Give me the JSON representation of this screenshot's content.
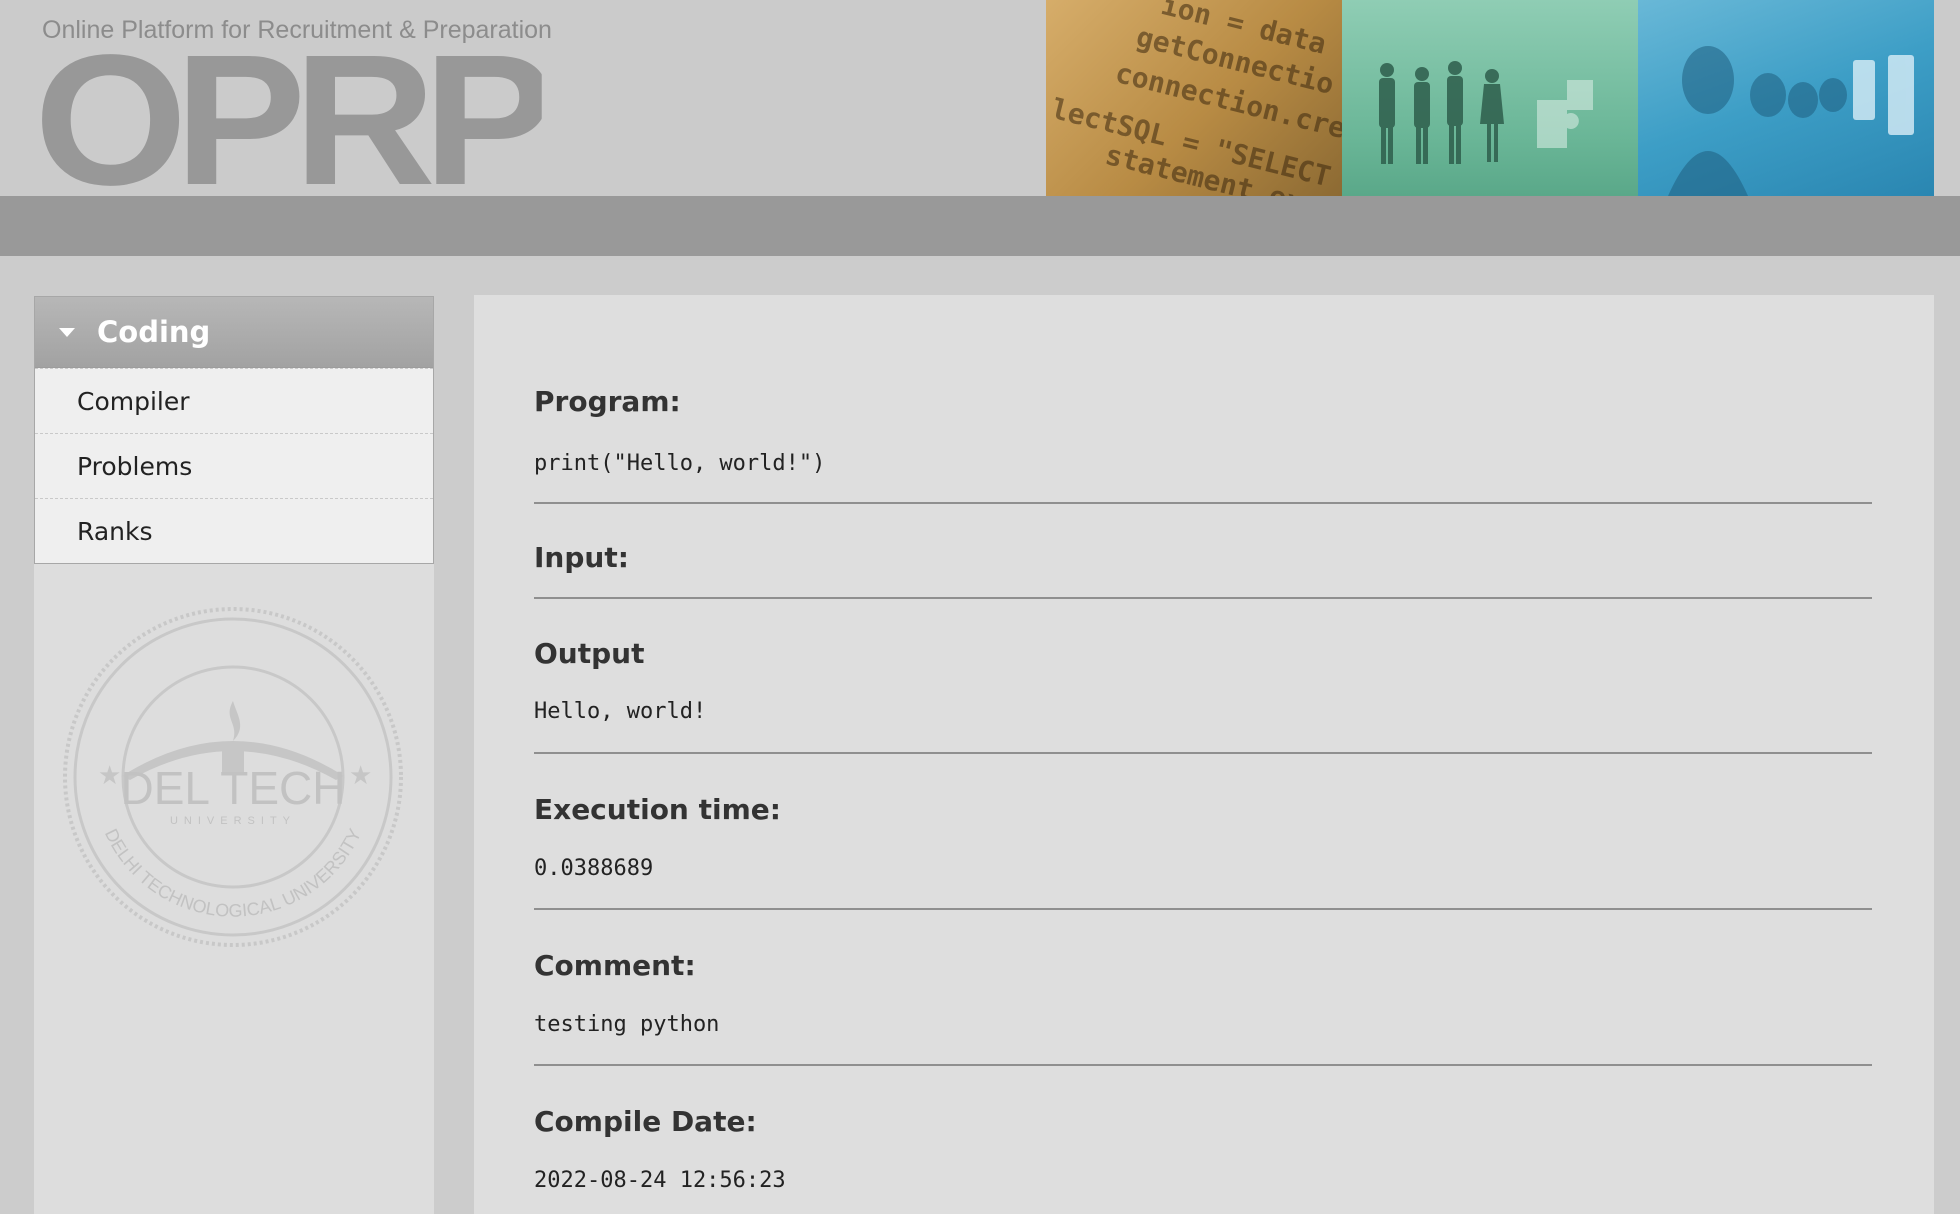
{
  "header": {
    "tagline": "Online Platform for Recruitment & Preparation",
    "logo_text": "OPRP",
    "banner_code_lines": [
      "ion = data",
      "getConnectio",
      "connection.crea",
      "lectSQL = \"SELECT",
      "statement.exec"
    ]
  },
  "sidebar": {
    "menu_title": "Coding",
    "items": [
      {
        "label": "Compiler"
      },
      {
        "label": "Problems"
      },
      {
        "label": "Ranks"
      }
    ],
    "seal_text": {
      "center": "DEL TECH",
      "bottom": "DELHI TECHNOLOGICAL UNIVERSITY",
      "sub": "UNIVERSITY"
    }
  },
  "result": {
    "program_label": "Program:",
    "program_value": "print(\"Hello, world!\")",
    "input_label": "Input:",
    "input_value": "",
    "output_label": "Output",
    "output_value": "Hello, world!",
    "exec_label": "Execution time:",
    "exec_value": "0.0388689",
    "comment_label": "Comment:",
    "comment_value": "testing python",
    "date_label": "Compile Date:",
    "date_value": "2022-08-24 12:56:23"
  },
  "colors": {
    "page_bg": "#cccccc",
    "header_bar": "#999999",
    "panel_bg": "#dedede",
    "menu_head": "#a8a8a8"
  },
  "icons": [
    "caret-down-icon",
    "university-seal-icon"
  ]
}
